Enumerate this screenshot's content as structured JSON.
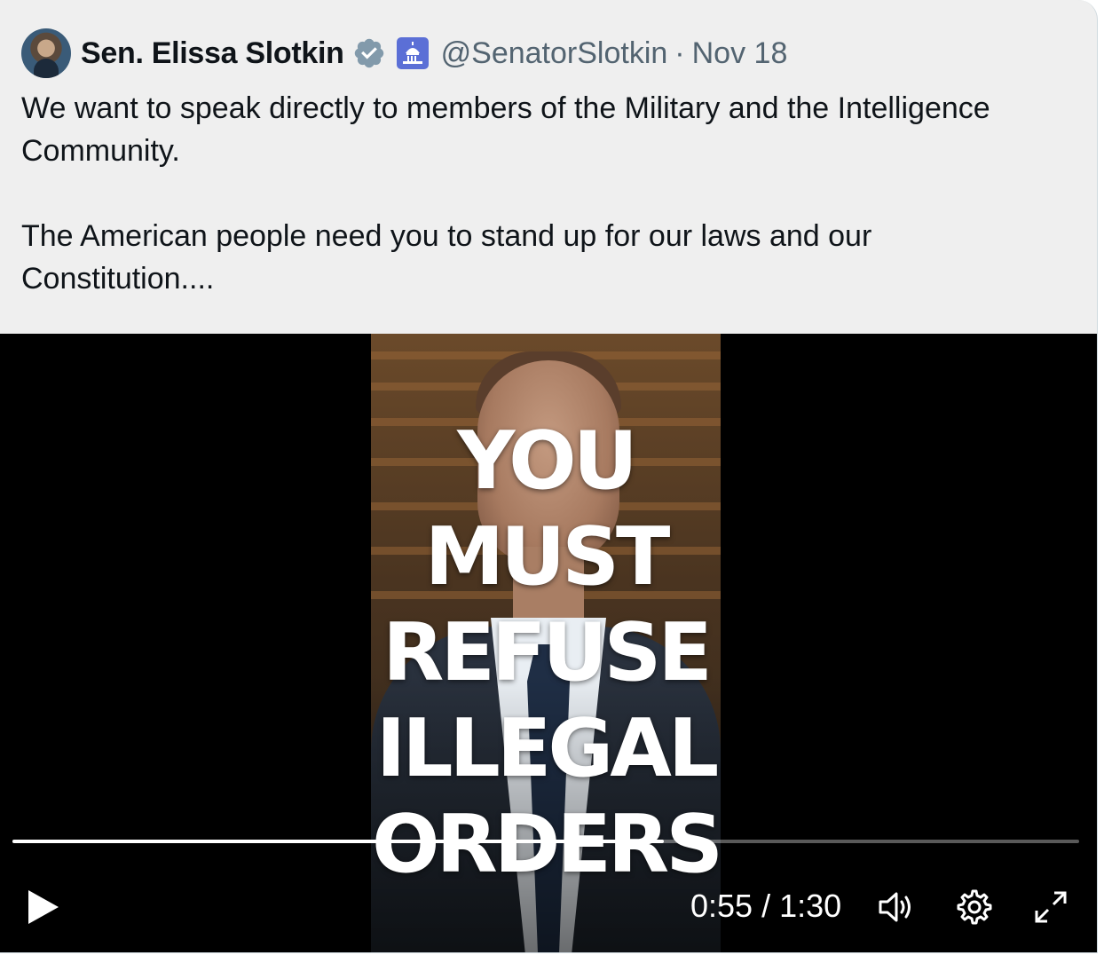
{
  "tweet": {
    "author_name": "Sen. Elissa Slotkin",
    "handle": "@SenatorSlotkin",
    "separator": "·",
    "date": "Nov 18",
    "paragraphs": [
      "We want to speak directly to members of the Military and the Intelligence Community.",
      "The American people need you to stand up for our laws and our Constitution...."
    ]
  },
  "video": {
    "overlay_lines": [
      "YOU",
      "MUST",
      "REFUSE",
      "ILLEGAL",
      "ORDERS"
    ],
    "time_display": "0:55 / 1:30",
    "current_time": "0:55",
    "duration": "1:30",
    "progress_fraction": 0.611
  },
  "colors": {
    "verified_badge": "#829aab",
    "gov_badge": "#5b6fd6",
    "secondary_text": "#536471",
    "primary_text": "#0f1419"
  },
  "icons": {
    "verified": "verified-check-icon",
    "gov": "capitol-icon",
    "play": "play-icon",
    "volume": "volume-icon",
    "settings": "gear-icon",
    "fullscreen": "expand-icon"
  }
}
